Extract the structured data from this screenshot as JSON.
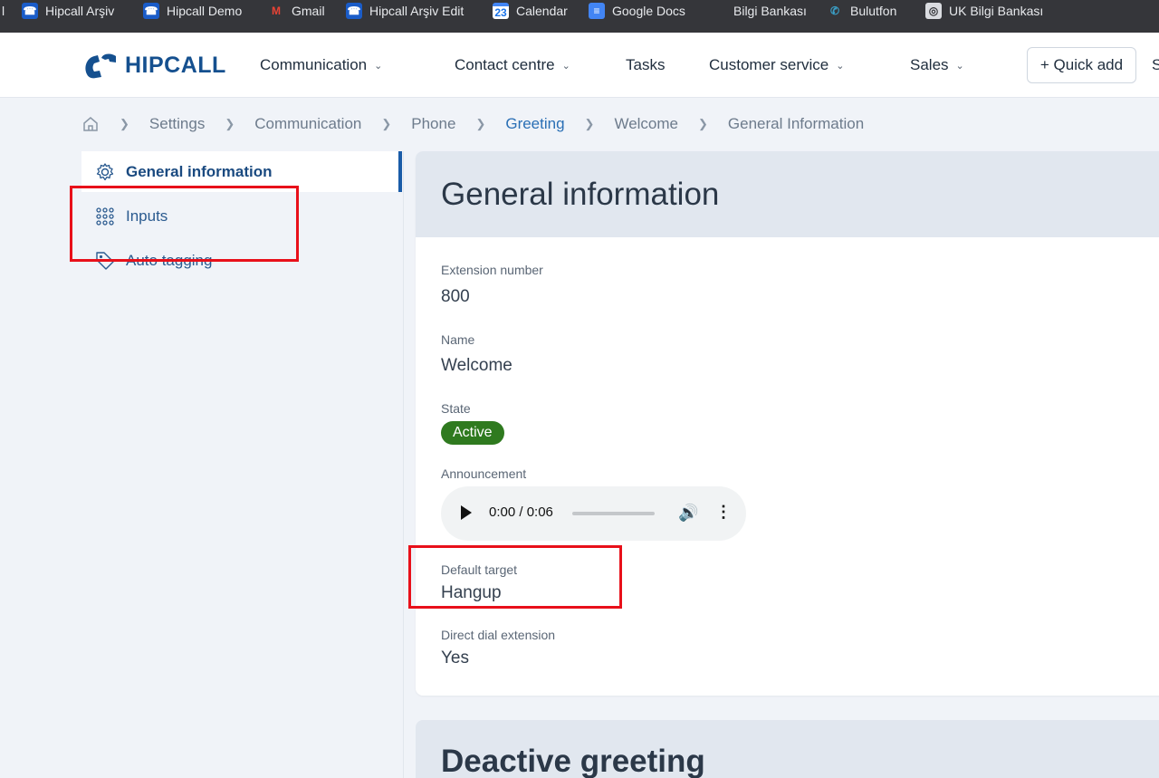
{
  "bookmarks": [
    {
      "label": "Hipcall  Arşiv",
      "icon": "hipcall-icon"
    },
    {
      "label": "Hipcall Demo",
      "icon": "hipcall-icon"
    },
    {
      "label": "Gmail",
      "icon": "gmail-icon"
    },
    {
      "label": "Hipcall  Arşiv Edit",
      "icon": "hipcall-icon"
    },
    {
      "label": "Calendar",
      "icon": "calendar-icon"
    },
    {
      "label": "Google Docs",
      "icon": "google-docs-icon"
    },
    {
      "label": "Bilgi Bankası",
      "icon": ""
    },
    {
      "label": "Bulutfon",
      "icon": "bulutfon-icon"
    },
    {
      "label": "UK Bilgi Bankası",
      "icon": "globe-icon"
    }
  ],
  "bookmarks_first_fragment": "l",
  "calendar_day": "23",
  "header": {
    "logo_text": "HIPCALL",
    "nav": [
      {
        "label": "Communication",
        "has_dropdown": true
      },
      {
        "label": "Contact centre",
        "has_dropdown": true
      },
      {
        "label": "Tasks",
        "has_dropdown": false
      },
      {
        "label": "Customer service",
        "has_dropdown": true
      },
      {
        "label": "Sales",
        "has_dropdown": true
      }
    ],
    "quick_add_label": "+ Quick add",
    "overflow_fragment": "S"
  },
  "breadcrumb": {
    "home_icon": "home-icon",
    "items": [
      "Settings",
      "Communication",
      "Phone",
      "Greeting",
      "Welcome",
      "General Information"
    ]
  },
  "sidebar": {
    "items": [
      {
        "label": "General information",
        "icon": "gear-icon",
        "active": true
      },
      {
        "label": "Inputs",
        "icon": "keypad-icon",
        "active": false
      },
      {
        "label": "Auto tagging",
        "icon": "tag-icon",
        "active": false
      }
    ]
  },
  "main": {
    "title": "General information",
    "fields": {
      "extension_label": "Extension number",
      "extension_value": "800",
      "name_label": "Name",
      "name_value": "Welcome",
      "state_label": "State",
      "state_value": "Active",
      "announcement_label": "Announcement",
      "default_target_label": "Default target",
      "default_target_value": "Hangup",
      "direct_dial_label": "Direct dial extension",
      "direct_dial_value": "Yes"
    },
    "audio": {
      "time": "0:00 / 0:06",
      "volume_fraction": 0.71
    }
  },
  "second_card": {
    "title": "Deactive greeting"
  },
  "colors": {
    "accent": "#1a5ca8",
    "active_badge": "#2f7a1f",
    "highlight": "#e8101a",
    "bookmarks_bg": "#35363a"
  }
}
